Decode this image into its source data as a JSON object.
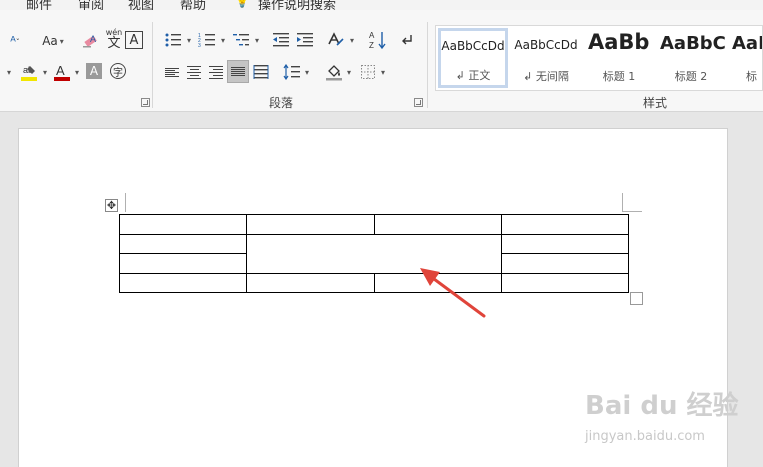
{
  "menu_tabs": [
    "邮件",
    "审阅",
    "视图",
    "帮助",
    "操作说明搜索"
  ],
  "ribbon": {
    "font_group": {
      "change_case_label": "Aa",
      "phonetic_label": "wén",
      "phonetic_char": "文",
      "border_char": "A",
      "font_color_char": "A",
      "shading_char": "A",
      "enclose_char": "字"
    },
    "paragraph_group": {
      "label": "段落"
    },
    "styles_group": {
      "label": "样式",
      "styles": [
        {
          "sample": "AaBbCcDd",
          "name": "正文",
          "selected": true
        },
        {
          "sample": "AaBbCcDd",
          "name": "无间隔",
          "selected": false
        },
        {
          "sample": "AaBb",
          "name": "标题 1",
          "selected": false
        },
        {
          "sample": "AaBbC",
          "name": "标题 2",
          "selected": false
        },
        {
          "sample": "AaBl",
          "name": "标",
          "selected": false
        }
      ]
    }
  },
  "colors": {
    "highlight": "#f2e600",
    "font_color": "#c00000",
    "arrow": "#e0443a"
  },
  "document": {
    "table": {
      "rows": 4,
      "columns": 4,
      "merged_cell": "rows 2-3, columns 2-3"
    }
  },
  "watermark": {
    "logo": "Bai du 经验",
    "url": "jingyan.baidu.com"
  }
}
